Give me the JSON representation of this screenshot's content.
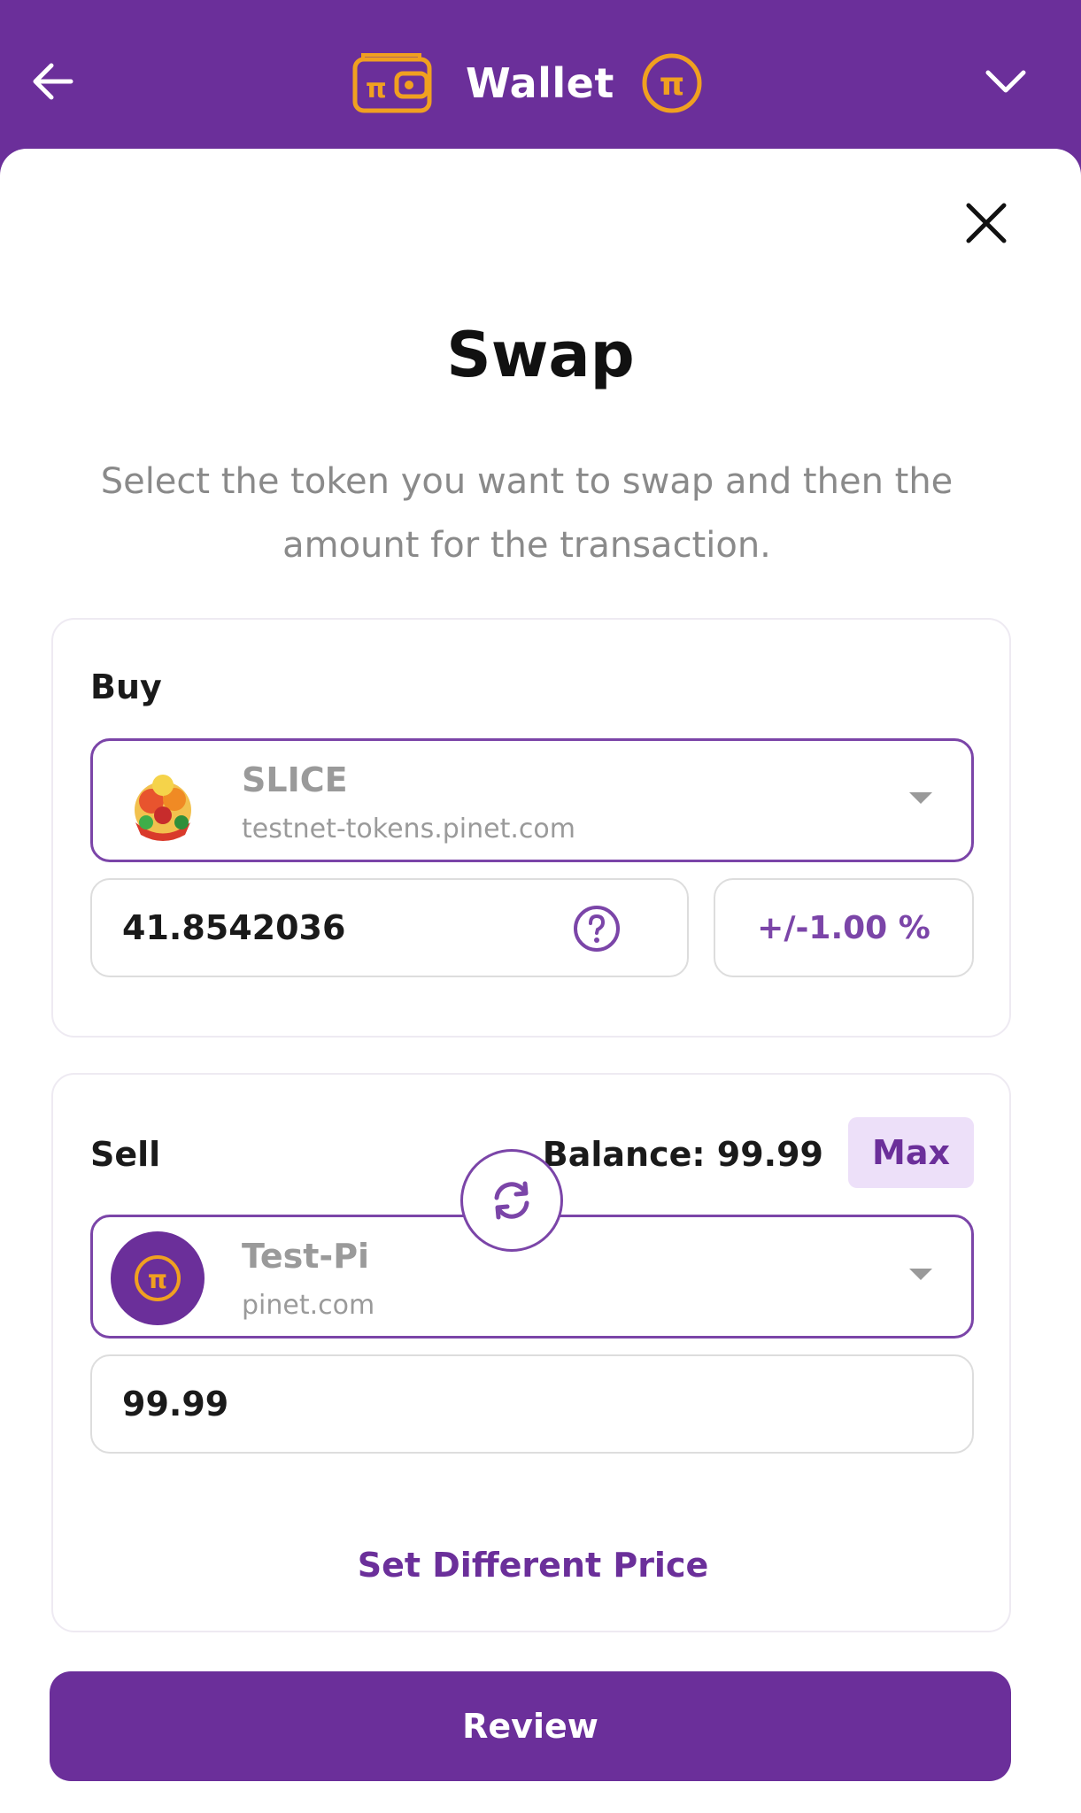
{
  "header": {
    "title": "Wallet",
    "back_icon": "arrow-left-icon",
    "menu_icon": "chevron-down-icon"
  },
  "dialog": {
    "title": "Swap",
    "subtitle": "Select the token you want to swap and then the amount for the transaction.",
    "close_icon": "close-icon"
  },
  "buy": {
    "label": "Buy",
    "token_name": "SLICE",
    "token_domain": "testnet-tokens.pinet.com",
    "amount": "41.8542036",
    "slippage": "+/-1.00 %"
  },
  "sell": {
    "label": "Sell",
    "balance": "Balance: 99.99",
    "max_label": "Max",
    "token_name": "Test-Pi",
    "token_domain": "pinet.com",
    "amount": "99.99",
    "set_price_label": "Set Different Price"
  },
  "review_label": "Review",
  "colors": {
    "brand": "#6b2f9a",
    "accent_orange": "#f0a020",
    "max_bg": "#ede0f9"
  }
}
